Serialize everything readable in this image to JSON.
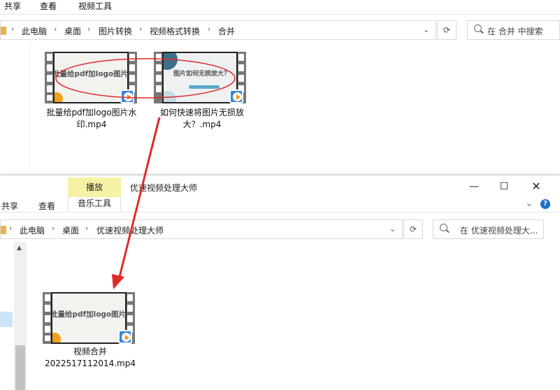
{
  "top_window": {
    "ribbon_tabs": [
      "共享",
      "查看",
      "视频工具"
    ],
    "breadcrumb": [
      "此电脑",
      "桌面",
      "图片转换",
      "视频格式转换",
      "合并"
    ],
    "search_placeholder": "在 合并 中搜索",
    "files": [
      {
        "thumb_title": "批量给pdf加logo图片水印",
        "name": "批量给pdf加logo图片水印.mp4"
      },
      {
        "thumb_title": "图片如何无损放大？",
        "name": "如何快速将图片无损放大？.mp4"
      }
    ]
  },
  "bottom_window": {
    "title": "优速视频处理大师",
    "context_tab": "播放",
    "context_subtab": "音乐工具",
    "ribbon_tabs": [
      "共享",
      "查看"
    ],
    "breadcrumb": [
      "此电脑",
      "桌面",
      "优速视频处理大师"
    ],
    "search_placeholder": "在 优速视频处理大...",
    "help_label": "?",
    "files": [
      {
        "thumb_title": "批量给pdf加logo图片水印",
        "name_line1": "视频合并",
        "name_line2": "2022517112014.mp4"
      }
    ]
  },
  "annotation": {
    "color": "#e02a2a"
  }
}
